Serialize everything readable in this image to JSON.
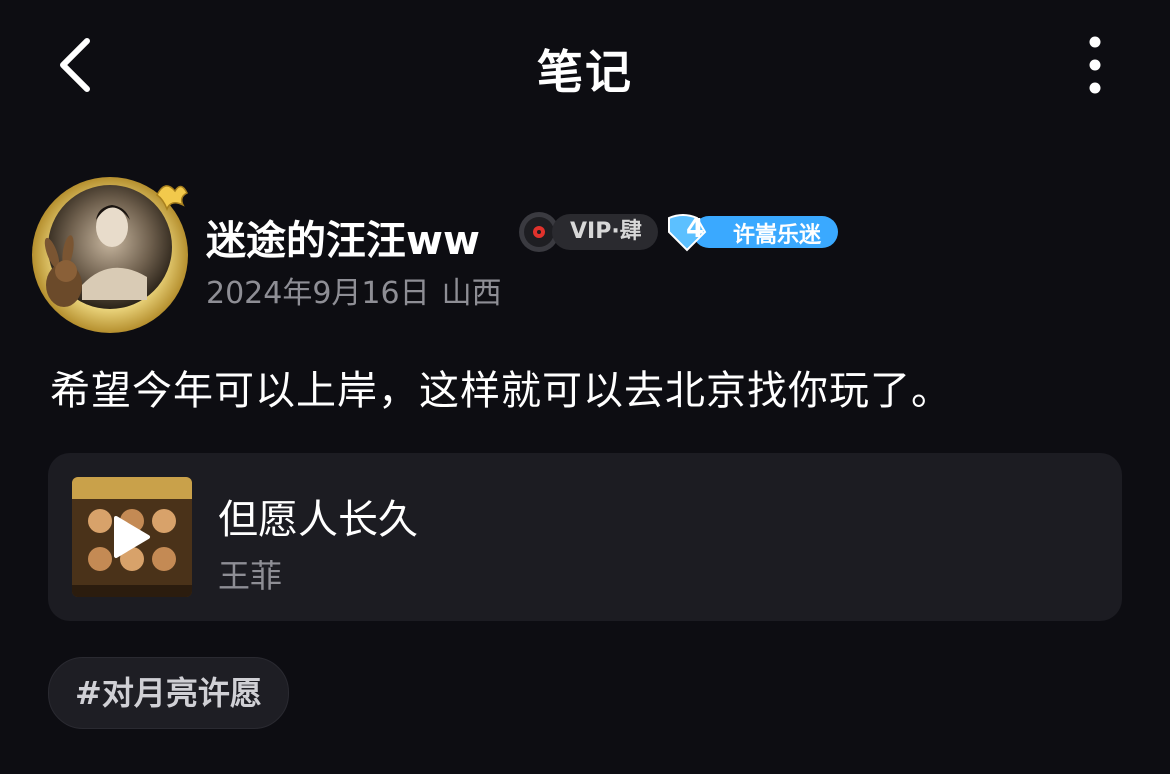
{
  "header": {
    "title": "笔记",
    "back_icon": "chevron-left-icon",
    "more_icon": "more-vertical-icon"
  },
  "author": {
    "name": "迷途的汪汪ww",
    "vip_badge": "VIP·肆",
    "fan_level": "4",
    "fan_badge_label": "许嵩乐迷",
    "date": "2024年9月16日",
    "location": "山西"
  },
  "post": {
    "text": "希望今年可以上岸，这样就可以去北京找你玩了。"
  },
  "song": {
    "title": "但愿人长久",
    "artist": "王菲"
  },
  "topic": {
    "label": "#对月亮许愿"
  },
  "colors": {
    "background": "#0d0d12",
    "card": "#1c1c22",
    "muted_text": "#8e8e95",
    "fan_badge": "#3aa9ff"
  }
}
